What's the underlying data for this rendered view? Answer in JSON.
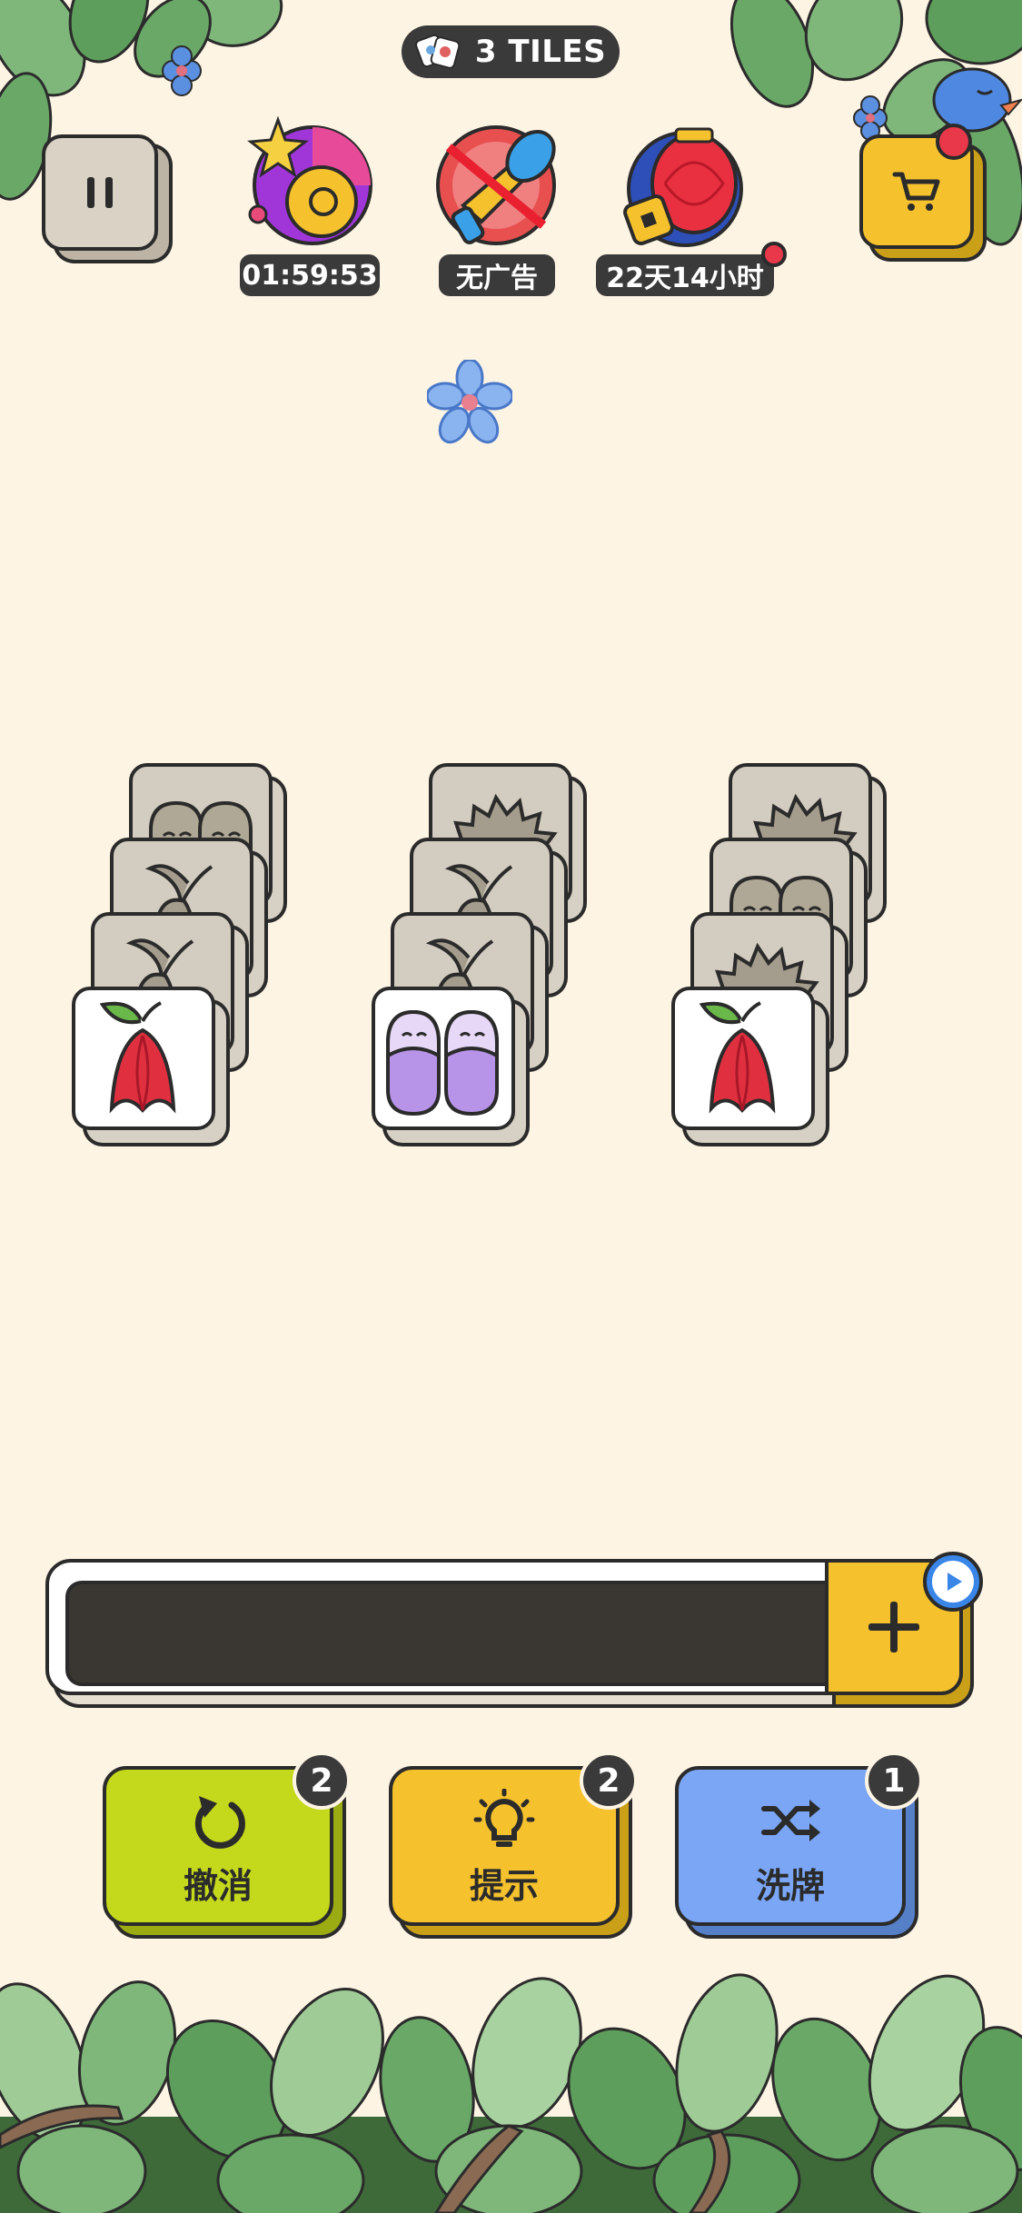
{
  "header": {
    "tiles_count_label": "3 TILES"
  },
  "top_badges": [
    {
      "name": "magic-wand",
      "label": "01:59:53"
    },
    {
      "name": "no-ads",
      "label": "无广告"
    },
    {
      "name": "lantern",
      "label": "22天14小时",
      "has_notification": true
    }
  ],
  "buttons": {
    "pause_icon": "pause-icon",
    "cart_icon": "cart-icon",
    "cart_has_notification": true
  },
  "board": {
    "columns": [
      {
        "stack": [
          "mooncake",
          "leaf",
          "leaf"
        ],
        "top": "red-flower"
      },
      {
        "stack": [
          "hedgehog",
          "leaf",
          "leaf"
        ],
        "top": "purple-slippers"
      },
      {
        "stack": [
          "hedgehog",
          "mooncake",
          "hedgehog"
        ],
        "top": "red-flower"
      }
    ]
  },
  "slot_bar": {
    "add_icon": "plus-icon",
    "video_icon": "play-icon"
  },
  "powerups": [
    {
      "label": "撤消",
      "count": "2",
      "color": "#c4d81c",
      "shadow": "#9bab12",
      "icon": "undo-icon"
    },
    {
      "label": "提示",
      "count": "2",
      "color": "#f5c22d",
      "shadow": "#caa018",
      "icon": "bulb-icon"
    },
    {
      "label": "洗牌",
      "count": "1",
      "color": "#7aa6f5",
      "shadow": "#5580c8",
      "icon": "shuffle-icon"
    }
  ],
  "colors": {
    "background": "#fdf4e4",
    "dark": "#2b2b2b",
    "tile_back": "#d3ccc0",
    "leaf_green": "#6fa86b"
  }
}
